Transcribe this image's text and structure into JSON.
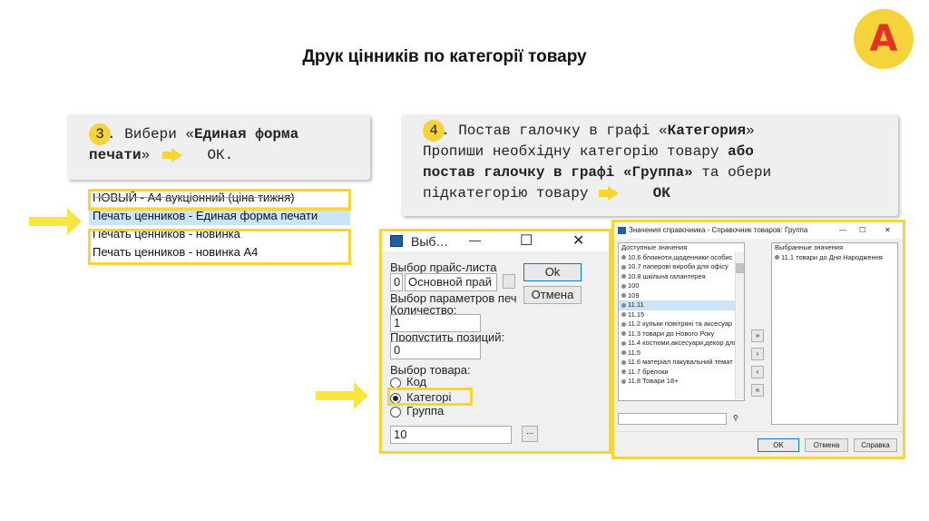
{
  "slide": {
    "title": "Друк цінників по категорії товару",
    "logo_letter": "А"
  },
  "step3": {
    "number": "3",
    "text_before": ". Вибери «",
    "bold_1": "Единая форма",
    "bold_2": "печати",
    "text_after": "»",
    "ok": "ОК."
  },
  "step4": {
    "number": "4",
    "line1_a": ". Постав галочку в графі «",
    "line1_b": "Категория",
    "line1_c": "»",
    "line2_a": "Пропиши необхідну категорію товару ",
    "line2_b": "або",
    "line3_a": "постав галочку в графі «Группа»",
    "line3_b": " та обери",
    "line4_a": "підкатегорію товару",
    "line4_b": "ОК"
  },
  "menu": {
    "items": [
      "НОВЫЙ - А4 аукціонний (ціна тижня)",
      "Печать ценников - Единая форма печати",
      "Печать ценников - новинка",
      "Печать ценников - новинка А4"
    ],
    "selected_index": 1
  },
  "dialog": {
    "title": "Выб…",
    "min": "—",
    "max": "☐",
    "close": "✕",
    "price_list_label": "Выбор прайс-листа",
    "price_list_code": "0",
    "price_list_name": "Основной прай",
    "ok": "Ok",
    "cancel": "Отмена",
    "params_label": "Выбор параметров печ",
    "qty_label": "Количество:",
    "qty_value": "1",
    "skip_label": "Пропустить позиций:",
    "skip_value": "0",
    "goods_label": "Выбор товара:",
    "radio_code": "Код",
    "radio_category": "Категорі",
    "radio_group": "Группа",
    "input_value": "10",
    "browse": "..."
  },
  "ref": {
    "title": "Значения справочника - Справочник товаров: Группа",
    "available_header": "Доступные значения",
    "available": [
      "10.6 блокноти,щоденники особис",
      "10.7 паперові вироби для офісу",
      "10.8 шкільна галантерея",
      "100",
      "109",
      "11.11",
      "11.15",
      "11.2 кульки повітряні та аксесуар",
      "11.3 товари до Нового Року",
      "11.4 костюми,аксесуари,декор для",
      "11.5",
      "11.6 матеріал пакувальний темат",
      "11.7 брелоки",
      "11.8 Товари 18+"
    ],
    "selected_available_index": 5,
    "selected_header": "Выбранные значения",
    "selected": [
      "11.1 товари до Дня Народження"
    ],
    "move_buttons": [
      "»",
      "›",
      "‹",
      "«"
    ],
    "ok": "OK",
    "cancel": "Отмена",
    "help": "Справка"
  },
  "colors": {
    "accent_yellow": "#f7d630",
    "logo_red": "#e53226",
    "selection_blue": "#cce4f7"
  }
}
